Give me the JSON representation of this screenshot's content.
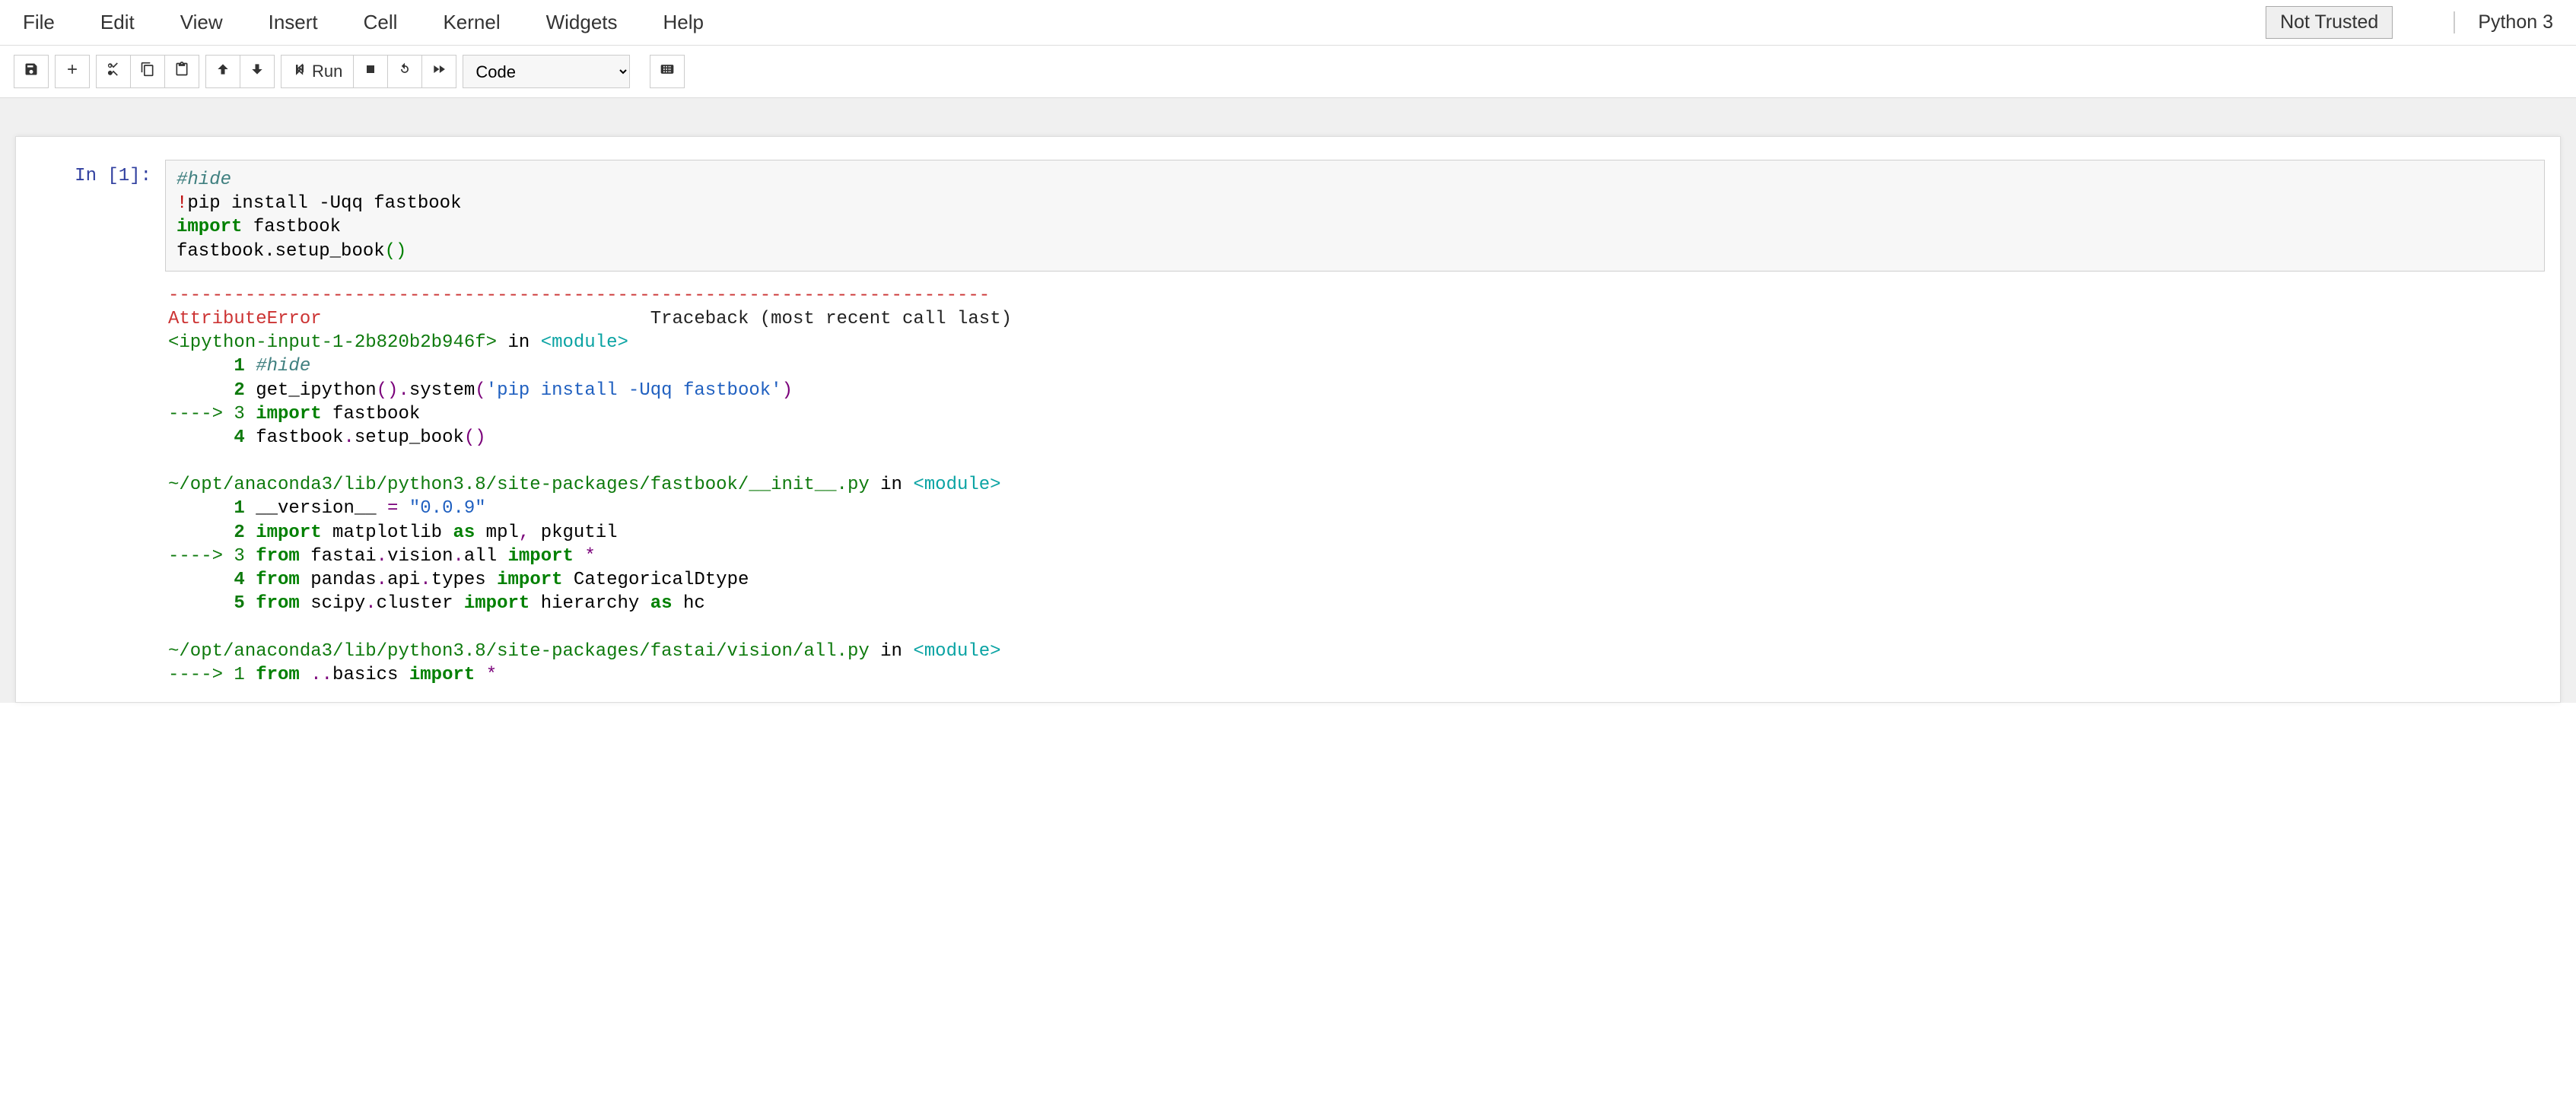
{
  "menu": {
    "file": "File",
    "edit": "Edit",
    "view": "View",
    "insert": "Insert",
    "cell": "Cell",
    "kernel": "Kernel",
    "widgets": "Widgets",
    "help": "Help"
  },
  "header": {
    "not_trusted": "Not Trusted",
    "kernel_name": "Python 3"
  },
  "toolbar": {
    "run_label": "Run",
    "cell_type_value": "Code"
  },
  "cell": {
    "prompt": "In [1]:",
    "code": {
      "l1_comment": "#hide",
      "l2_bang": "!",
      "l2_rest": "pip install -Uqq fastbook",
      "l3_kw": "import",
      "l3_rest": " fastbook",
      "l4_a": "fastbook",
      "l4_dot": ".",
      "l4_b": "setup_book",
      "l4_paren": "()"
    },
    "output": {
      "dashline": "---------------------------------------------------------------------------",
      "err_name": "AttributeError",
      "err_pad": "                              ",
      "traceback_label": "Traceback (most recent call last)",
      "frame1_path": "<ipython-input-1-2b820b2b946f>",
      "in": " in ",
      "module": "<module>",
      "f1_l1_num": "      1 ",
      "f1_l1_txt": "#hide",
      "f1_l2_num": "      2 ",
      "f1_l2_a": "get_ipython",
      "f1_l2_paren1": "()",
      "f1_l2_dot": ".",
      "f1_l2_b": "system",
      "f1_l2_paren2": "(",
      "f1_l2_str": "'pip install -Uqq fastbook'",
      "f1_l2_paren3": ")",
      "f1_l3_arrow": "----> 3 ",
      "f1_l3_kw": "import",
      "f1_l3_rest": " fastbook",
      "f1_l4_num": "      4 ",
      "f1_l4_a": "fastbook",
      "f1_l4_dot": ".",
      "f1_l4_b": "setup_book",
      "f1_l4_paren": "()",
      "frame2_path": "~/opt/anaconda3/lib/python3.8/site-packages/fastbook/__init__.py",
      "f2_l1_num": "      1 ",
      "f2_l1_a": "__version__ ",
      "f2_l1_eq": "=",
      "f2_l1_str": " \"0.0.9\"",
      "f2_l2_num": "      2 ",
      "f2_l2_kw": "import",
      "f2_l2_a": " matplotlib ",
      "f2_l2_as": "as",
      "f2_l2_b": " mpl",
      "f2_l2_comma": ",",
      "f2_l2_c": " pkgutil",
      "f2_l3_arrow": "----> 3 ",
      "f2_l3_from": "from",
      "f2_l3_a": " fastai",
      "f2_l3_dot1": ".",
      "f2_l3_b": "vision",
      "f2_l3_dot2": ".",
      "f2_l3_c": "all ",
      "f2_l3_import": "import",
      "f2_l3_star": " *",
      "f2_l4_num": "      4 ",
      "f2_l4_from": "from",
      "f2_l4_a": " pandas",
      "f2_l4_dot1": ".",
      "f2_l4_b": "api",
      "f2_l4_dot2": ".",
      "f2_l4_c": "types ",
      "f2_l4_import": "import",
      "f2_l4_d": " CategoricalDtype",
      "f2_l5_num": "      5 ",
      "f2_l5_from": "from",
      "f2_l5_a": " scipy",
      "f2_l5_dot1": ".",
      "f2_l5_b": "cluster ",
      "f2_l5_import": "import",
      "f2_l5_c": " hierarchy ",
      "f2_l5_as": "as",
      "f2_l5_d": " hc",
      "frame3_path": "~/opt/anaconda3/lib/python3.8/site-packages/fastai/vision/all.py",
      "f3_l1_arrow": "----> 1 ",
      "f3_l1_from": "from",
      "f3_l1_a": " ",
      "f3_l1_dot1": ".",
      "f3_l1_dot2": ".",
      "f3_l1_b": "basics ",
      "f3_l1_import": "import",
      "f3_l1_star": " *"
    }
  }
}
